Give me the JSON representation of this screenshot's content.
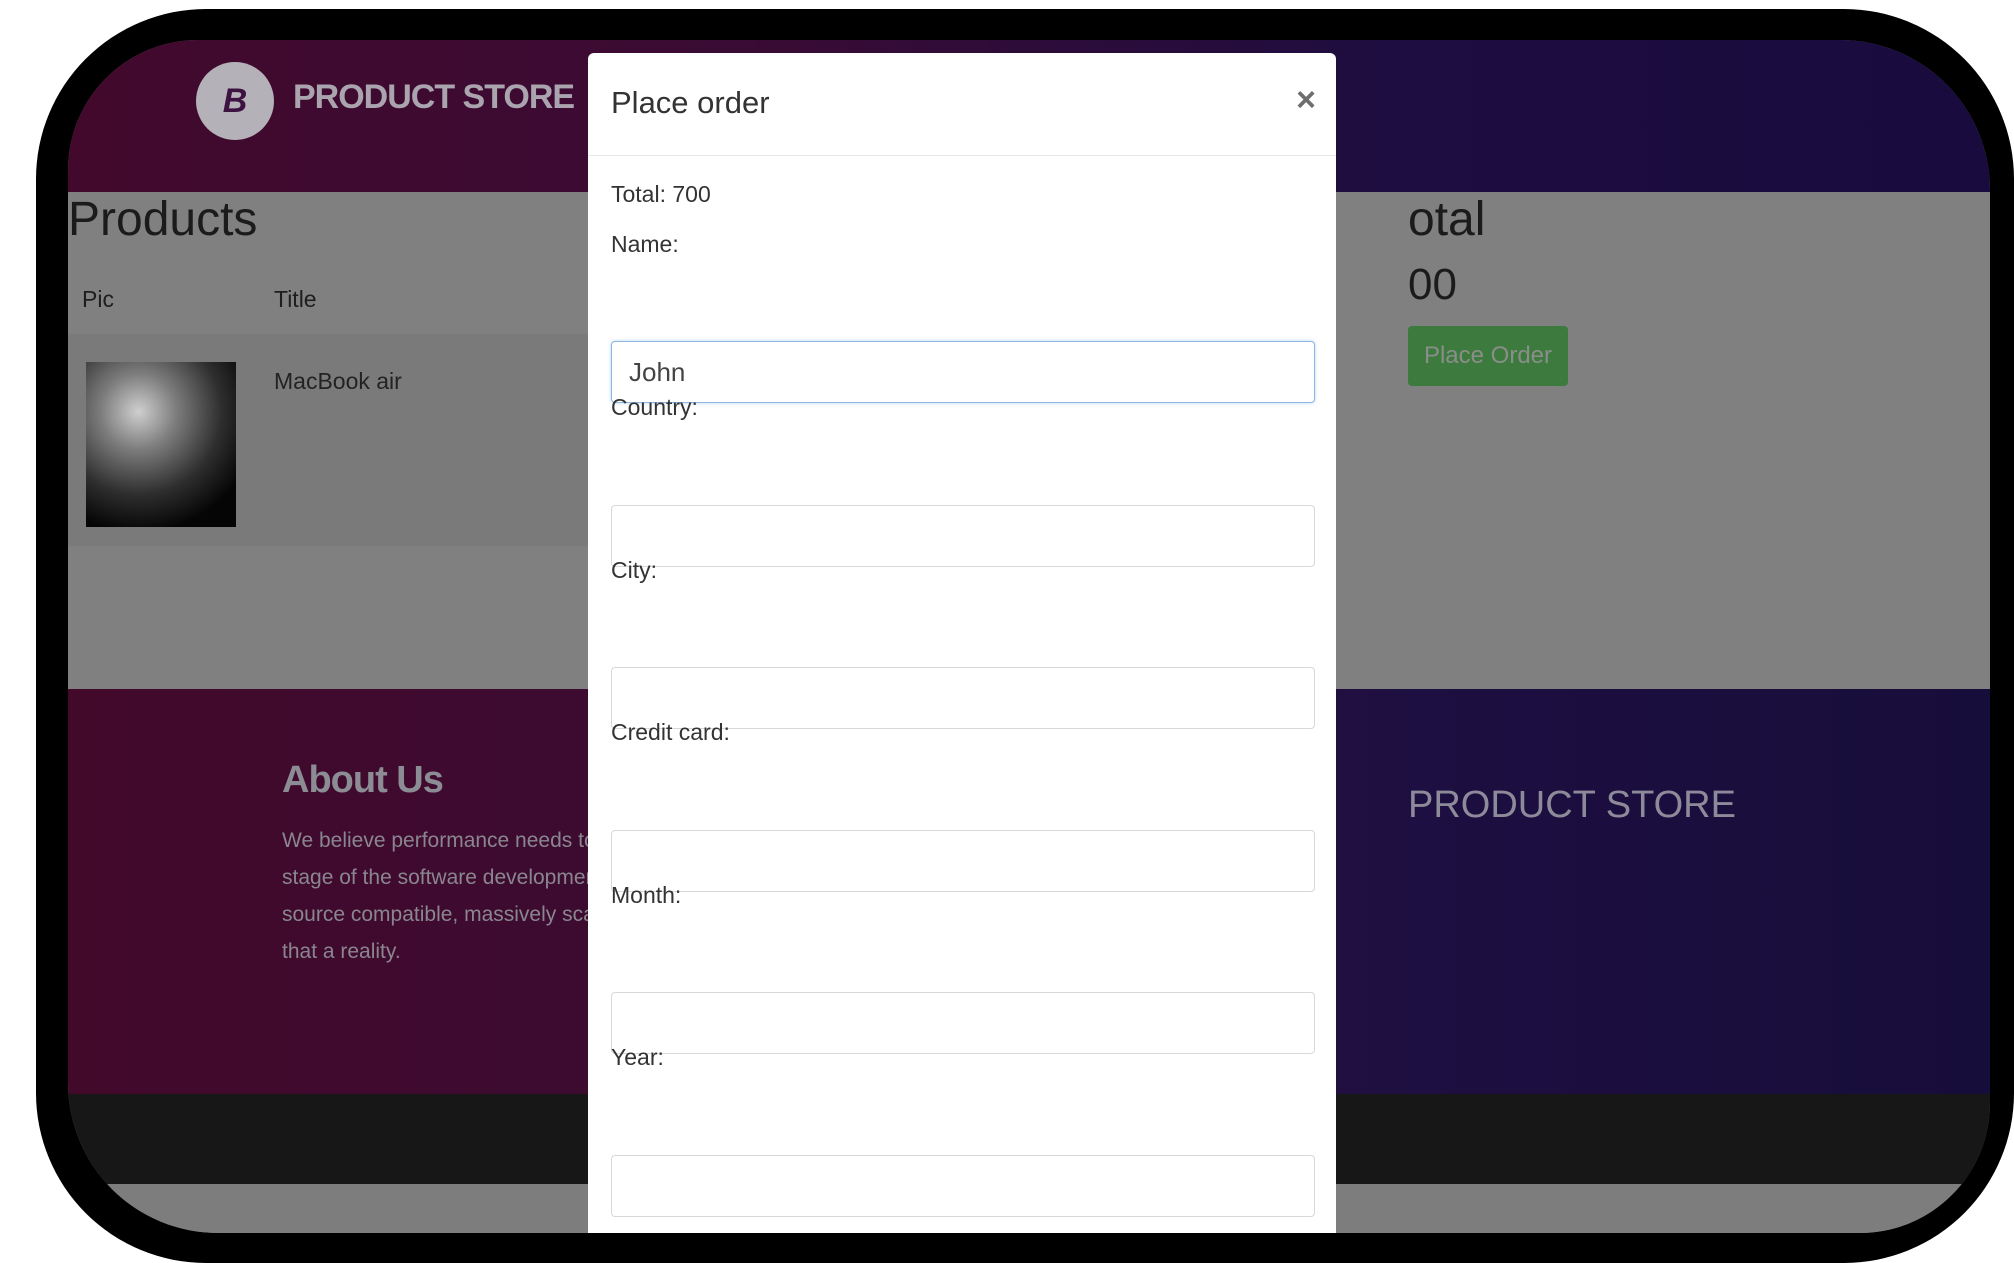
{
  "navbar": {
    "logo_letter": "B",
    "brand": "PRODUCT STORE"
  },
  "page": {
    "products_heading": "Products",
    "columns": [
      "Pic",
      "Title"
    ],
    "item": {
      "title": "MacBook air"
    },
    "total_heading": "otal",
    "total_value": "00",
    "place_order_button": "Place Order"
  },
  "footer": {
    "about_heading": "About Us",
    "about_text": "We believe performance needs to be v\nstage of the software development cyc\nsource compatible, massively scalable \nthat a reality.",
    "brand": "PRODUCT STORE"
  },
  "modal": {
    "title": "Place order",
    "close": "×",
    "total": "Total: 700",
    "fields": [
      {
        "label": "Name:",
        "value": "John"
      },
      {
        "label": "Country:",
        "value": ""
      },
      {
        "label": "City:",
        "value": ""
      },
      {
        "label": "Credit card:",
        "value": ""
      },
      {
        "label": "Month:",
        "value": ""
      },
      {
        "label": "Year:",
        "value": ""
      }
    ]
  }
}
